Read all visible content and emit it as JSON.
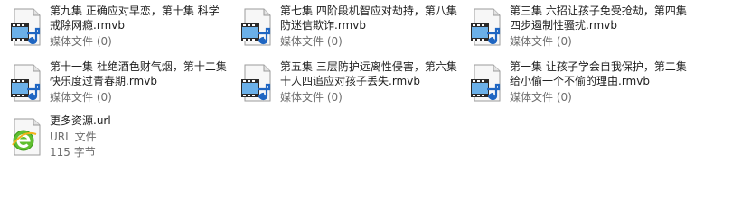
{
  "files": [
    {
      "name": "第九集 正确应对早恋，第十集 科学戒除网瘾.rmvb",
      "type": "媒体文件",
      "detail": "(0)",
      "icon": "media-file-icon"
    },
    {
      "name": "第七集 四阶段机智应对劫持，第八集 防迷信欺诈.rmvb",
      "type": "媒体文件",
      "detail": "(0)",
      "icon": "media-file-icon"
    },
    {
      "name": "第三集 六招让孩子免受抢劫，第四集 四步遏制性骚扰.rmvb",
      "type": "媒体文件",
      "detail": "(0)",
      "icon": "media-file-icon"
    },
    {
      "name": "第十一集 杜绝酒色财气烟，第十二集 快乐度过青春期.rmvb",
      "type": "媒体文件",
      "detail": "(0)",
      "icon": "media-file-icon"
    },
    {
      "name": "第五集 三层防护远离性侵害，第六集 十人四追应对孩子丢失.rmvb",
      "type": "媒体文件",
      "detail": "(0)",
      "icon": "media-file-icon"
    },
    {
      "name": "第一集 让孩子学会自我保护，第二集 给小偷一个不偷的理由.rmvb",
      "type": "媒体文件",
      "detail": "(0)",
      "icon": "media-file-icon"
    },
    {
      "name": "更多资源.url",
      "type": "URL 文件",
      "detail": "115 字节",
      "icon": "internet-shortcut-icon"
    }
  ]
}
